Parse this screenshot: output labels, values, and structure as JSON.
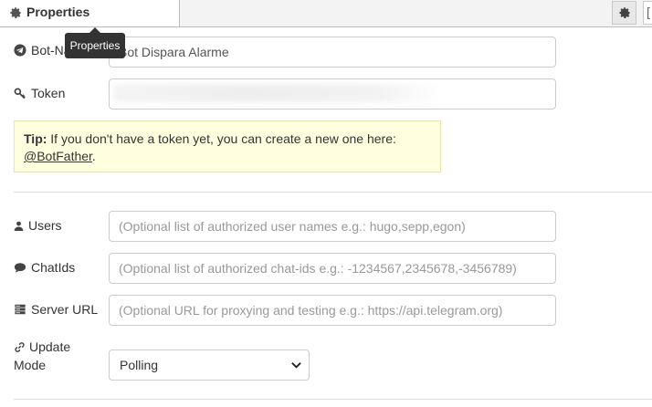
{
  "tabs": {
    "properties_label": "Properties",
    "extra_label": "["
  },
  "tooltip": {
    "text": "Properties"
  },
  "fields": {
    "bot_name": {
      "label": "Bot-Name",
      "value": "Bot Dispara Alarme"
    },
    "token": {
      "label": "Token",
      "value": ""
    },
    "users": {
      "label": "Users",
      "placeholder": "(Optional list of authorized user names e.g.: hugo,sepp,egon)"
    },
    "chatids": {
      "label": "ChatIds",
      "placeholder": "(Optional list of authorized chat-ids e.g.: -1234567,2345678,-3456789)"
    },
    "server_url": {
      "label": "Server URL",
      "placeholder": "(Optional URL for proxying and testing e.g.: https://api.telegram.org)"
    },
    "update_mode": {
      "label_line1": "Update",
      "label_line2": "Mode",
      "value": "Polling"
    }
  },
  "tip": {
    "prefix": "Tip:",
    "text": " If you don't have a token yet, you can create a new one here:",
    "link": "@BotFather",
    "suffix": "."
  },
  "icons": {
    "tab": "gear-icon",
    "bot_name": "telegram-plane-icon",
    "token": "key-icon",
    "users": "user-icon",
    "chatids": "comment-icon",
    "server_url": "server-icon",
    "update_mode": "link-icon"
  },
  "colors": {
    "tip_background": "#ffffe0",
    "tooltip_background": "#333333"
  }
}
